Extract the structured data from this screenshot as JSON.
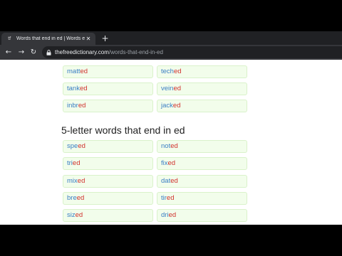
{
  "browser": {
    "tab": {
      "favicon_text": "tf",
      "title": "Words that end in ed | Words en",
      "close_glyph": "✕"
    },
    "new_tab_glyph": "+",
    "nav": {
      "back_glyph": "←",
      "forward_glyph": "→",
      "reload_glyph": "↻"
    },
    "url": {
      "host": "thefreedictionary.com",
      "path": "/words-that-end-in-ed"
    }
  },
  "page": {
    "top_words": [
      {
        "stem": "matt",
        "suffix": "ed"
      },
      {
        "stem": "tech",
        "suffix": "ed"
      },
      {
        "stem": "tank",
        "suffix": "ed"
      },
      {
        "stem": "vein",
        "suffix": "ed"
      },
      {
        "stem": "inbr",
        "suffix": "ed"
      },
      {
        "stem": "jack",
        "suffix": "ed"
      }
    ],
    "section_title": "5-letter words that end in ed",
    "five_letter_words": [
      {
        "stem": "spe",
        "suffix": "ed"
      },
      {
        "stem": "not",
        "suffix": "ed"
      },
      {
        "stem": "tri",
        "suffix": "ed"
      },
      {
        "stem": "fix",
        "suffix": "ed"
      },
      {
        "stem": "mix",
        "suffix": "ed"
      },
      {
        "stem": "dat",
        "suffix": "ed"
      },
      {
        "stem": "bre",
        "suffix": "ed"
      },
      {
        "stem": "tir",
        "suffix": "ed"
      },
      {
        "stem": "siz",
        "suffix": "ed"
      },
      {
        "stem": "dri",
        "suffix": "ed"
      }
    ]
  },
  "colors": {
    "stem": "#3a7ec4",
    "suffix": "#d0312d",
    "chip_bg": "#f2fdeb",
    "chip_border": "#d9f2ca"
  }
}
